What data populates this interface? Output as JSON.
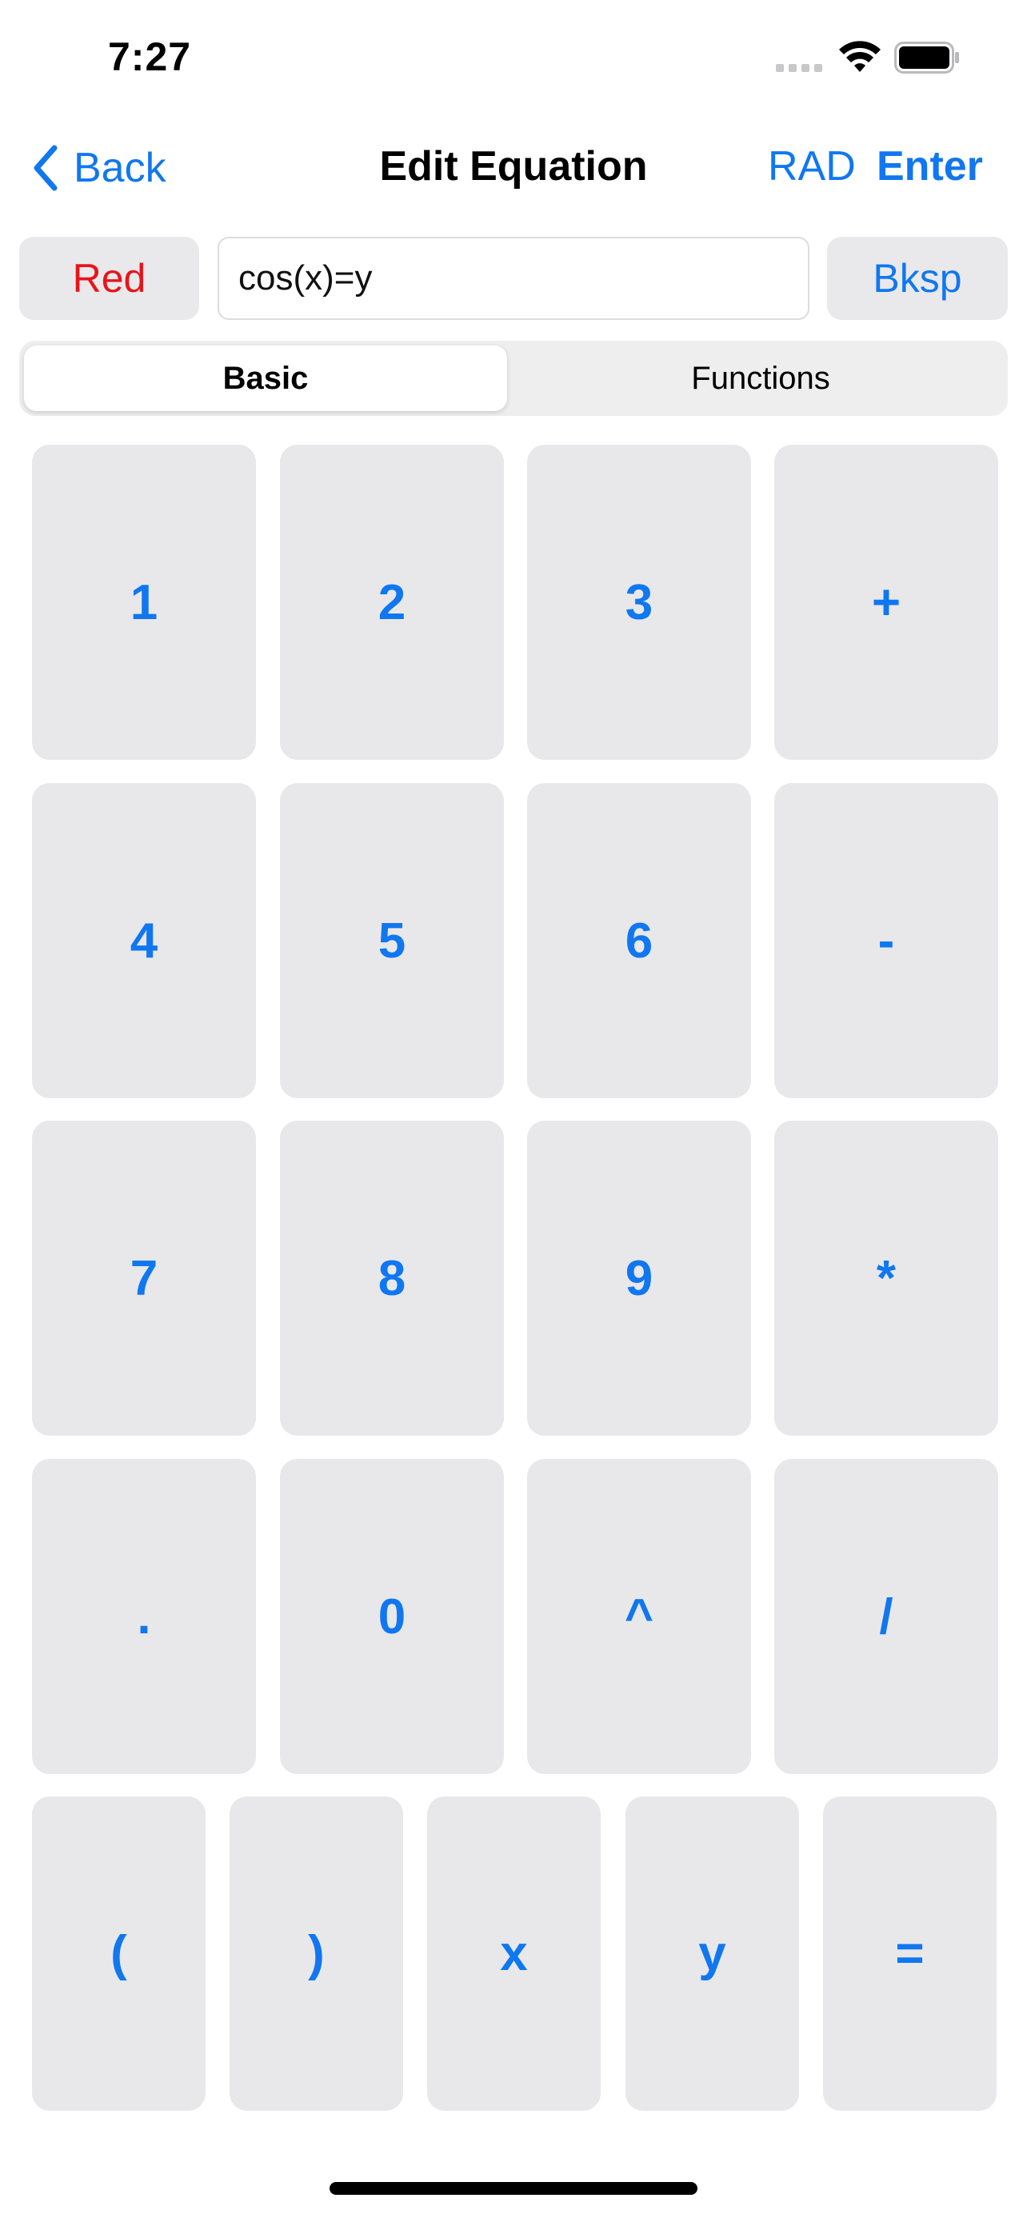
{
  "status_bar": {
    "time": "7:27"
  },
  "nav": {
    "back_label": "Back",
    "title": "Edit Equation",
    "rad_label": "RAD",
    "enter_label": "Enter"
  },
  "toolbar": {
    "color_label": "Red",
    "color_value": "#e8141a",
    "equation_value": "cos(x)=y",
    "backspace_label": "Bksp"
  },
  "segments": {
    "basic": "Basic",
    "functions": "Functions",
    "selected": "Basic"
  },
  "keys": {
    "row1": [
      "1",
      "2",
      "3",
      "+"
    ],
    "row2": [
      "4",
      "5",
      "6",
      "-"
    ],
    "row3": [
      "7",
      "8",
      "9",
      "*"
    ],
    "row4": [
      ".",
      "0",
      "^",
      "/"
    ],
    "row5": [
      "(",
      ")",
      "x",
      "y",
      "="
    ]
  },
  "colors": {
    "accent": "#1077f0",
    "key_background": "#e8e8eb"
  }
}
